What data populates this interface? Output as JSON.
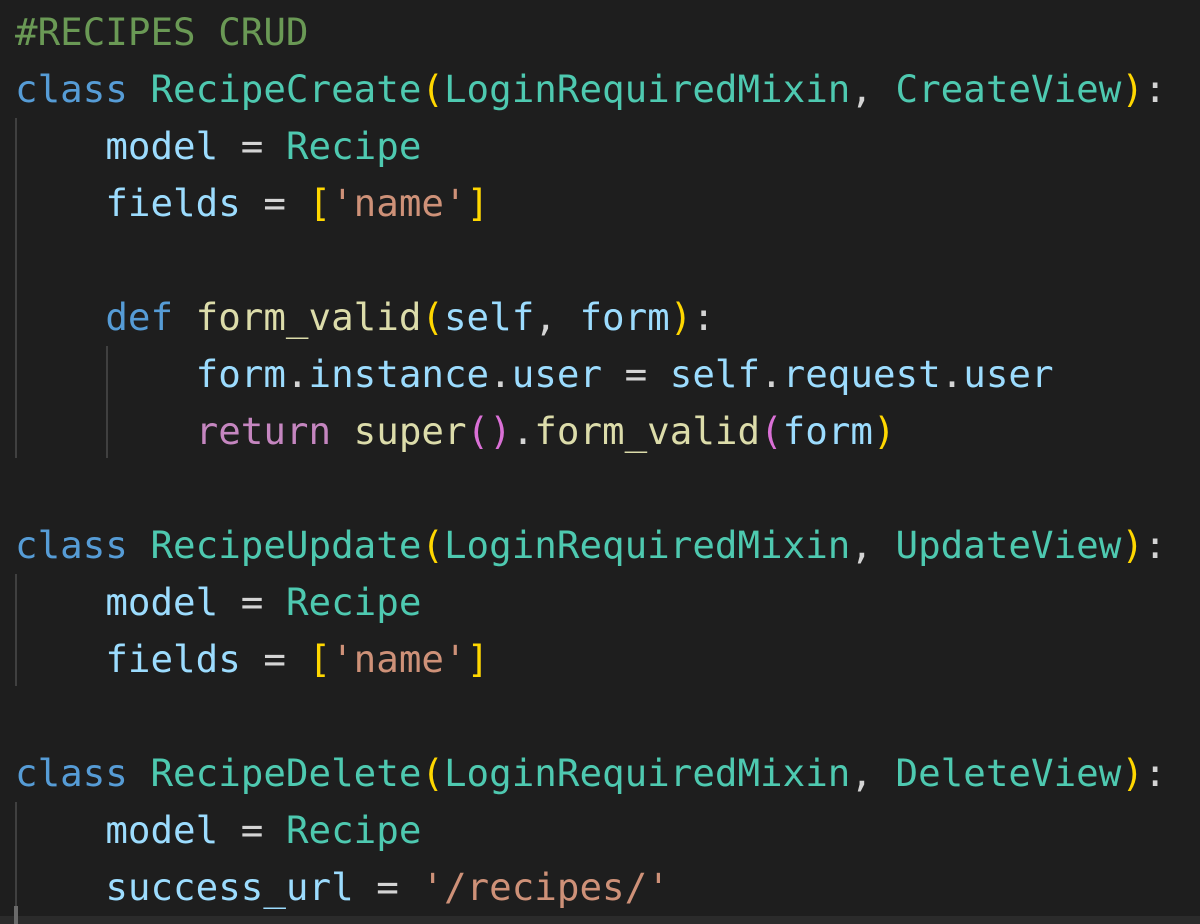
{
  "colors": {
    "background": "#1e1e1e",
    "comment": "#6a9955",
    "keyword": "#569cd6",
    "class_name": "#4ec9b0",
    "function_name": "#dcdcaa",
    "variable": "#9cdcfe",
    "string": "#ce9178",
    "control_keyword": "#c586c0",
    "bracket": "#ffd700",
    "inner_bracket": "#da70d6",
    "punctuation": "#d4d4d4"
  },
  "code_lines": [
    [
      {
        "text": "#RECIPES CRUD",
        "type": "comment"
      }
    ],
    [
      {
        "text": "class",
        "type": "keyword"
      },
      {
        "text": " ",
        "type": "punctuation"
      },
      {
        "text": "RecipeCreate",
        "type": "class_name"
      },
      {
        "text": "(",
        "type": "bracket"
      },
      {
        "text": "LoginRequiredMixin",
        "type": "class_name"
      },
      {
        "text": ", ",
        "type": "punctuation"
      },
      {
        "text": "CreateView",
        "type": "class_name"
      },
      {
        "text": ")",
        "type": "bracket"
      },
      {
        "text": ":",
        "type": "punctuation"
      }
    ],
    [
      {
        "text": "    ",
        "type": "punctuation"
      },
      {
        "text": "model",
        "type": "variable"
      },
      {
        "text": " = ",
        "type": "punctuation"
      },
      {
        "text": "Recipe",
        "type": "class_name"
      }
    ],
    [
      {
        "text": "    ",
        "type": "punctuation"
      },
      {
        "text": "fields",
        "type": "variable"
      },
      {
        "text": " = ",
        "type": "punctuation"
      },
      {
        "text": "[",
        "type": "bracket"
      },
      {
        "text": "'name'",
        "type": "string"
      },
      {
        "text": "]",
        "type": "bracket"
      }
    ],
    [],
    [
      {
        "text": "    ",
        "type": "punctuation"
      },
      {
        "text": "def",
        "type": "keyword"
      },
      {
        "text": " ",
        "type": "punctuation"
      },
      {
        "text": "form_valid",
        "type": "function_name"
      },
      {
        "text": "(",
        "type": "bracket"
      },
      {
        "text": "self",
        "type": "variable"
      },
      {
        "text": ", ",
        "type": "punctuation"
      },
      {
        "text": "form",
        "type": "variable"
      },
      {
        "text": ")",
        "type": "bracket"
      },
      {
        "text": ":",
        "type": "punctuation"
      }
    ],
    [
      {
        "text": "        ",
        "type": "punctuation"
      },
      {
        "text": "form",
        "type": "variable"
      },
      {
        "text": ".",
        "type": "punctuation"
      },
      {
        "text": "instance",
        "type": "variable"
      },
      {
        "text": ".",
        "type": "punctuation"
      },
      {
        "text": "user",
        "type": "variable"
      },
      {
        "text": " = ",
        "type": "punctuation"
      },
      {
        "text": "self",
        "type": "variable"
      },
      {
        "text": ".",
        "type": "punctuation"
      },
      {
        "text": "request",
        "type": "variable"
      },
      {
        "text": ".",
        "type": "punctuation"
      },
      {
        "text": "user",
        "type": "variable"
      }
    ],
    [
      {
        "text": "        ",
        "type": "punctuation"
      },
      {
        "text": "return",
        "type": "control_keyword"
      },
      {
        "text": " ",
        "type": "punctuation"
      },
      {
        "text": "super",
        "type": "function_name"
      },
      {
        "text": "()",
        "type": "inner_bracket"
      },
      {
        "text": ".",
        "type": "punctuation"
      },
      {
        "text": "form_valid",
        "type": "function_name"
      },
      {
        "text": "(",
        "type": "inner_bracket"
      },
      {
        "text": "form",
        "type": "variable"
      },
      {
        "text": ")",
        "type": "bracket"
      }
    ],
    [],
    [
      {
        "text": "class",
        "type": "keyword"
      },
      {
        "text": " ",
        "type": "punctuation"
      },
      {
        "text": "RecipeUpdate",
        "type": "class_name"
      },
      {
        "text": "(",
        "type": "bracket"
      },
      {
        "text": "LoginRequiredMixin",
        "type": "class_name"
      },
      {
        "text": ", ",
        "type": "punctuation"
      },
      {
        "text": "UpdateView",
        "type": "class_name"
      },
      {
        "text": ")",
        "type": "bracket"
      },
      {
        "text": ":",
        "type": "punctuation"
      }
    ],
    [
      {
        "text": "    ",
        "type": "punctuation"
      },
      {
        "text": "model",
        "type": "variable"
      },
      {
        "text": " = ",
        "type": "punctuation"
      },
      {
        "text": "Recipe",
        "type": "class_name"
      }
    ],
    [
      {
        "text": "    ",
        "type": "punctuation"
      },
      {
        "text": "fields",
        "type": "variable"
      },
      {
        "text": " = ",
        "type": "punctuation"
      },
      {
        "text": "[",
        "type": "bracket"
      },
      {
        "text": "'name'",
        "type": "string"
      },
      {
        "text": "]",
        "type": "bracket"
      }
    ],
    [],
    [
      {
        "text": "class",
        "type": "keyword"
      },
      {
        "text": " ",
        "type": "punctuation"
      },
      {
        "text": "RecipeDelete",
        "type": "class_name"
      },
      {
        "text": "(",
        "type": "bracket"
      },
      {
        "text": "LoginRequiredMixin",
        "type": "class_name"
      },
      {
        "text": ", ",
        "type": "punctuation"
      },
      {
        "text": "DeleteView",
        "type": "class_name"
      },
      {
        "text": ")",
        "type": "bracket"
      },
      {
        "text": ":",
        "type": "punctuation"
      }
    ],
    [
      {
        "text": "    ",
        "type": "punctuation"
      },
      {
        "text": "model",
        "type": "variable"
      },
      {
        "text": " = ",
        "type": "punctuation"
      },
      {
        "text": "Recipe",
        "type": "class_name"
      }
    ],
    [
      {
        "text": "    ",
        "type": "punctuation"
      },
      {
        "text": "success_url",
        "type": "variable"
      },
      {
        "text": " = ",
        "type": "punctuation"
      },
      {
        "text": "'/recipes/'",
        "type": "string"
      }
    ]
  ]
}
